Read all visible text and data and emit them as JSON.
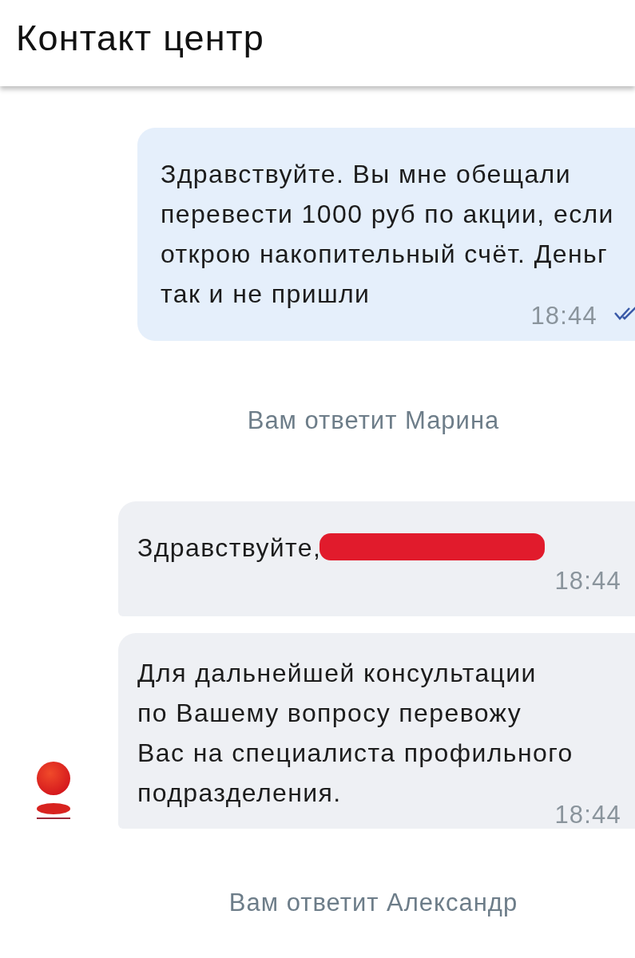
{
  "header": {
    "title": "Контакт центр"
  },
  "messages": [
    {
      "kind": "outgoing",
      "text": "Здравствуйте. Вы мне обещали\nперевести 1000 руб по акции, если\nоткрою накопительный счёт. Деньг\nтак и не пришли",
      "time": "18:44",
      "read": true
    },
    {
      "kind": "system",
      "text": "Вам ответит Марина"
    },
    {
      "kind": "incoming",
      "text": "Здравствуйте,",
      "redacted": true,
      "time": "18:44"
    },
    {
      "kind": "incoming",
      "text": "Для дальнейшей консультации\nпо Вашему вопросу перевожу\nВас на специалиста профильного\nподразделения.",
      "time": "18:44",
      "avatar": true
    },
    {
      "kind": "system",
      "text": "Вам ответит Александр"
    }
  ]
}
